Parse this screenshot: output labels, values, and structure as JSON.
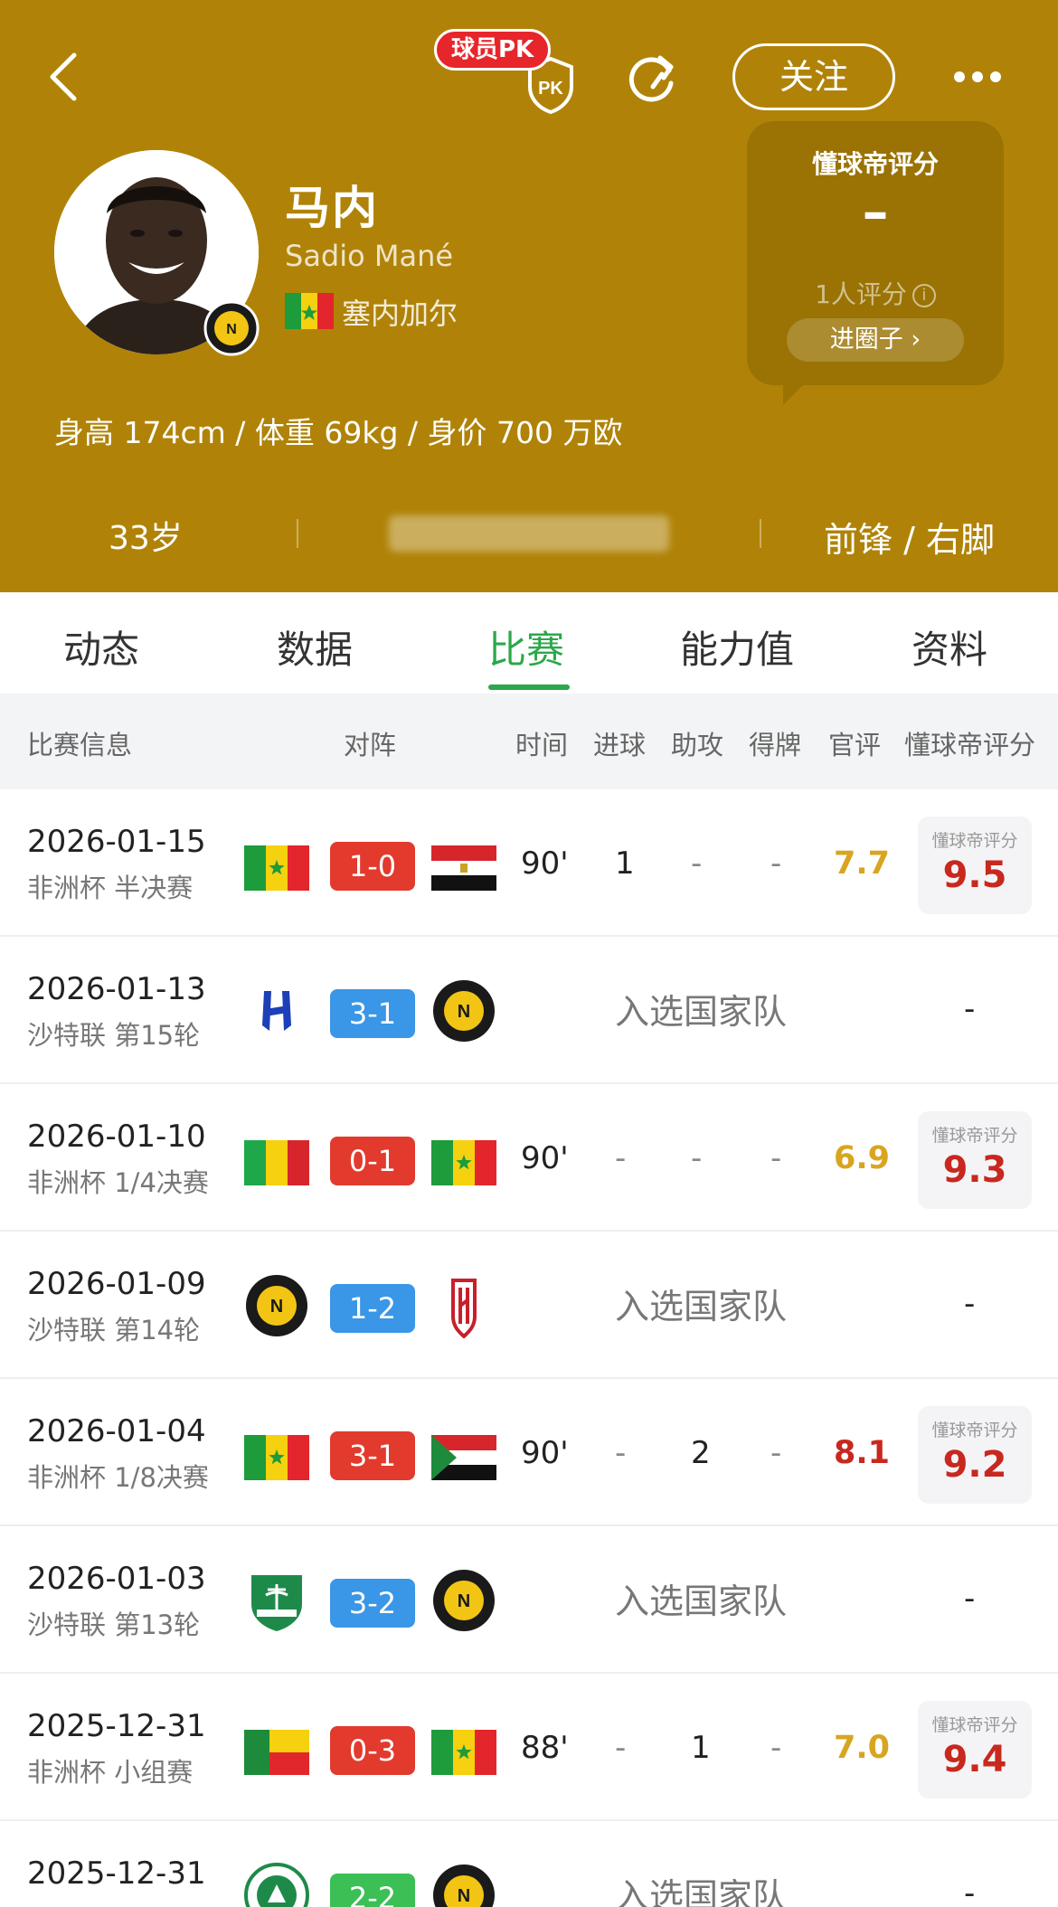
{
  "header": {
    "pk_label": "球员PK",
    "follow_label": "关注",
    "player": {
      "name": "马内",
      "name_en": "Sadio Mané",
      "nation": "塞内加尔",
      "bio": "身高 174cm / 体重 69kg / 身价 700 万欧",
      "age": "33岁",
      "position": "前锋 / 右脚"
    },
    "rating_card": {
      "title": "懂球帝评分",
      "value": "–",
      "count": "1人评分",
      "info": "i",
      "button": "进圈子 ›"
    }
  },
  "tabs": [
    "动态",
    "数据",
    "比赛",
    "能力值",
    "资料"
  ],
  "active_tab": "比赛",
  "table": {
    "headers": {
      "match_info": "比赛信息",
      "lineup": "对阵",
      "time": "时间",
      "goals": "进球",
      "assists": "助攻",
      "cards": "得牌",
      "official": "官评",
      "dqd": "懂球帝评分"
    },
    "rows": [
      {
        "date": "2026-01-15",
        "comp": "非洲杯 半决赛",
        "home": "senegal",
        "away": "egypt",
        "score": "1-0",
        "score_color": "red",
        "time": "90'",
        "goals": "1",
        "assists": "-",
        "cards": "-",
        "official": "7.7",
        "official_color": "gold",
        "dqd_label": "懂球帝评分",
        "dqd": "9.5"
      },
      {
        "date": "2026-01-13",
        "comp": "沙特联 第15轮",
        "home": "al-hilal",
        "away": "al-nassr",
        "score": "3-1",
        "score_color": "blue",
        "note": "入选国家队",
        "dqd": "-"
      },
      {
        "date": "2026-01-10",
        "comp": "非洲杯 1/4决赛",
        "home": "mali",
        "away": "senegal",
        "score": "0-1",
        "score_color": "red",
        "time": "90'",
        "goals": "-",
        "assists": "-",
        "cards": "-",
        "official": "6.9",
        "official_color": "gold",
        "dqd_label": "懂球帝评分",
        "dqd": "9.3"
      },
      {
        "date": "2026-01-09",
        "comp": "沙特联 第14轮",
        "home": "al-nassr",
        "away": "al-qadsiah",
        "score": "1-2",
        "score_color": "blue",
        "note": "入选国家队",
        "dqd": "-"
      },
      {
        "date": "2026-01-04",
        "comp": "非洲杯 1/8决赛",
        "home": "senegal",
        "away": "sudan",
        "score": "3-1",
        "score_color": "red",
        "time": "90'",
        "goals": "-",
        "assists": "2",
        "cards": "-",
        "official": "8.1",
        "official_color": "red",
        "dqd_label": "懂球帝评分",
        "dqd": "9.2"
      },
      {
        "date": "2026-01-03",
        "comp": "沙特联 第13轮",
        "home": "al-khaleej",
        "away": "al-nassr",
        "score": "3-2",
        "score_color": "blue",
        "note": "入选国家队",
        "dqd": "-"
      },
      {
        "date": "2025-12-31",
        "comp": "非洲杯 小组赛",
        "home": "benin",
        "away": "senegal",
        "score": "0-3",
        "score_color": "red",
        "time": "88'",
        "goals": "-",
        "assists": "1",
        "cards": "-",
        "official": "7.0",
        "official_color": "gold",
        "dqd_label": "懂球帝评分",
        "dqd": "9.4"
      },
      {
        "date": "2025-12-31",
        "comp": "",
        "home": "ettifaq",
        "away": "al-nassr",
        "score": "2-2",
        "score_color": "green",
        "note": "入选国家队",
        "dqd": "-"
      }
    ]
  }
}
